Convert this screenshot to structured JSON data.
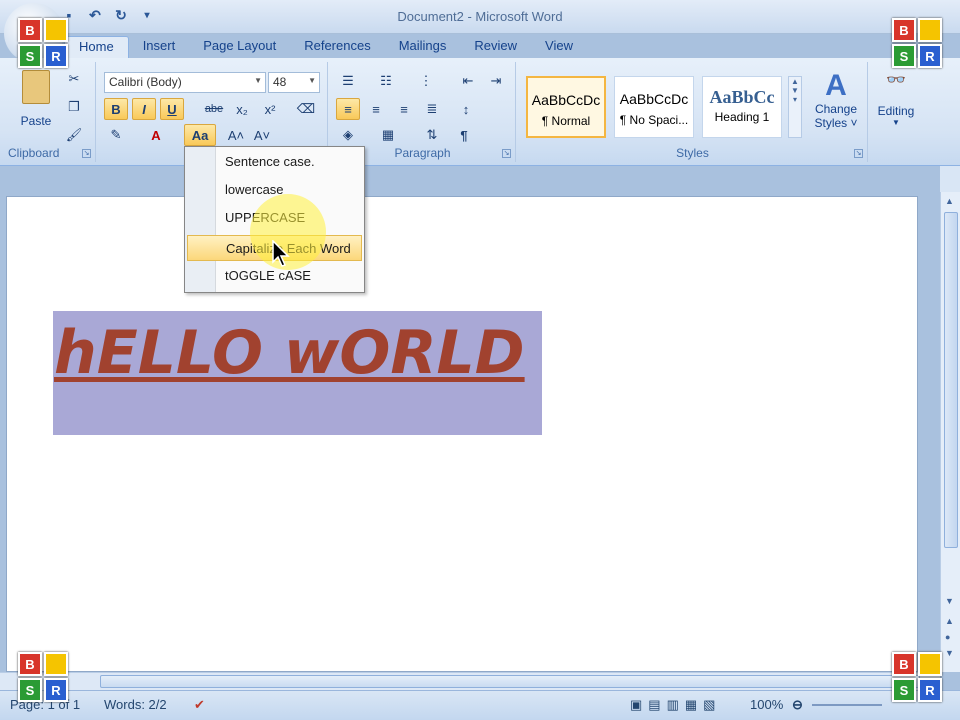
{
  "window": {
    "title": "Document2 - Microsoft Word"
  },
  "overlay_squares": [
    "B",
    "",
    "S",
    "R"
  ],
  "qat": {
    "save_icon": "save-icon",
    "undo_icon": "undo-icon",
    "redo_icon": "redo-icon",
    "customize_icon": "chevron-down-icon"
  },
  "tabs": [
    {
      "label": "Home",
      "active": true
    },
    {
      "label": "Insert"
    },
    {
      "label": "Page Layout"
    },
    {
      "label": "References"
    },
    {
      "label": "Mailings"
    },
    {
      "label": "Review"
    },
    {
      "label": "View"
    }
  ],
  "clipboard": {
    "paste_label": "Paste",
    "group_label": "Clipboard"
  },
  "font": {
    "name": "Calibri (Body)",
    "size": "48",
    "bold": "B",
    "italic": "I",
    "underline": "U",
    "strike": "abe",
    "subscript": "x₂",
    "superscript": "x²",
    "grow": "A˄",
    "shrink": "A˅",
    "change_case": "Aa"
  },
  "paragraph": {
    "group_label": "Paragraph",
    "pilcrow": "¶"
  },
  "styles": {
    "group_label": "Styles",
    "items": [
      {
        "sample": "AaBbCcDc",
        "name": "¶ Normal"
      },
      {
        "sample": "AaBbCcDc",
        "name": "¶ No Spaci..."
      },
      {
        "sample": "AaBbCс",
        "name": "Heading 1"
      }
    ],
    "change_styles_label_1": "Change",
    "change_styles_label_2": "Styles ˅"
  },
  "editing": {
    "label": "Editing"
  },
  "change_case_menu": {
    "items": [
      {
        "label": "Sentence case."
      },
      {
        "label": "lowercase"
      },
      {
        "label": "UPPERCASE"
      },
      {
        "label": "Capitalize Each Word",
        "highlighted": true
      },
      {
        "label": "tOGGLE cASE"
      }
    ]
  },
  "document": {
    "text": "hELLO wORLD"
  },
  "status": {
    "page": "Page: 1 of 1",
    "words": "Words: 2/2",
    "zoom": "100%"
  },
  "colors": {
    "text_color": "#a1422f",
    "selection": "#a9a8d6",
    "accent": "#15428b"
  }
}
